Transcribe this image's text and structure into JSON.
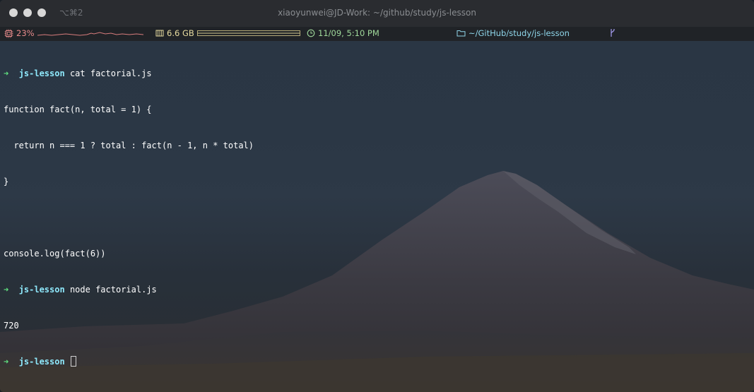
{
  "window": {
    "title": "xiaoyunwei@JD-Work: ~/github/study/js-lesson",
    "shortcut": "⌥⌘2"
  },
  "status_bar": {
    "cpu": "23%",
    "memory": "6.6 GB",
    "datetime": "11/09, 5:10 PM",
    "path": "~/GitHub/study/js-lesson",
    "branch_icon": "git-branch-icon",
    "colors": {
      "cpu": "#e88b8b",
      "memory": "#e8dca0",
      "time": "#9fd89a",
      "path": "#8fd6ea",
      "branch": "#a59cf0"
    }
  },
  "terminal": {
    "prompt_arrow": "➜",
    "prompt_dir": "js-lesson",
    "cmd1": " cat factorial.js",
    "code": [
      "function fact(n, total = 1) {",
      "  return n === 1 ? total : fact(n - 1, n * total)",
      "}",
      "",
      "console.log(fact(6))"
    ],
    "cmd2": " node factorial.js",
    "output": "720",
    "cmd3": " "
  }
}
